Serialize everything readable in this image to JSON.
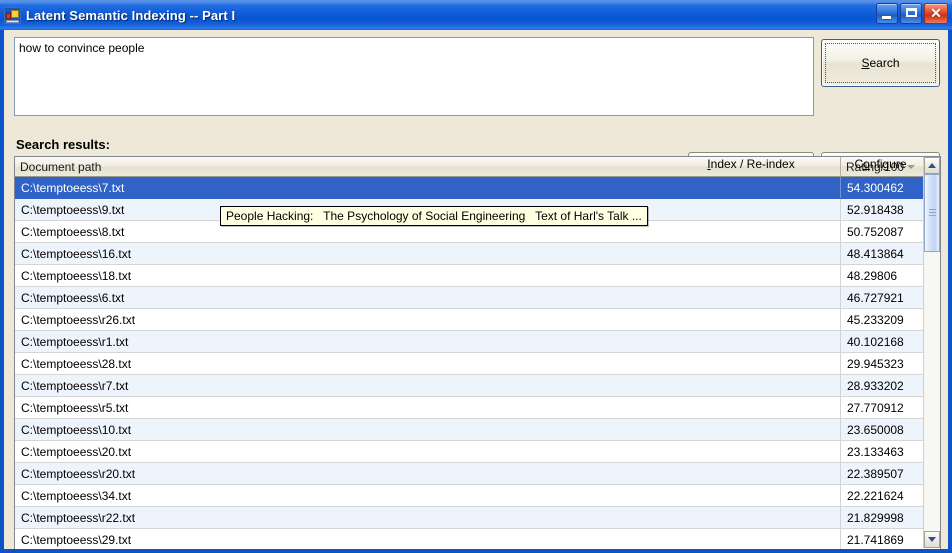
{
  "window": {
    "title": "Latent Semantic Indexing -- Part I",
    "icon": "app-icon",
    "minimize_label": "_",
    "maximize_label": "",
    "close_label": "✕",
    "titlebar_color": "#1C66DC",
    "client_background": "#EDE8D8"
  },
  "query": {
    "value": "how to convince people",
    "placeholder": ""
  },
  "buttons": {
    "search": {
      "prefix": "",
      "accel": "S",
      "suffix": "earch",
      "full": "Search"
    },
    "index": {
      "prefix": "",
      "accel": "I",
      "suffix": "ndex / Re-index",
      "full": "Index / Re-index"
    },
    "configure": {
      "prefix": "C",
      "accel": "o",
      "suffix": "nfigure",
      "full": "Configure"
    }
  },
  "results": {
    "label": "Search results:",
    "columns": [
      "Document path",
      "Rating/100"
    ],
    "selected_index": 0,
    "tooltip": "People Hacking:   The Psychology of Social Engineering   Text of Harl's Talk ...",
    "rows": [
      {
        "path": "C:\\temptoeess\\7.txt",
        "rating": "54.300462"
      },
      {
        "path": "C:\\temptoeess\\9.txt",
        "rating": "52.918438"
      },
      {
        "path": "C:\\temptoeess\\8.txt",
        "rating": "50.752087"
      },
      {
        "path": "C:\\temptoeess\\16.txt",
        "rating": "48.413864"
      },
      {
        "path": "C:\\temptoeess\\18.txt",
        "rating": "48.29806"
      },
      {
        "path": "C:\\temptoeess\\6.txt",
        "rating": "46.727921"
      },
      {
        "path": "C:\\temptoeess\\r26.txt",
        "rating": "45.233209"
      },
      {
        "path": "C:\\temptoeess\\r1.txt",
        "rating": "40.102168"
      },
      {
        "path": "C:\\temptoeess\\28.txt",
        "rating": "29.945323"
      },
      {
        "path": "C:\\temptoeess\\r7.txt",
        "rating": "28.933202"
      },
      {
        "path": "C:\\temptoeess\\r5.txt",
        "rating": "27.770912"
      },
      {
        "path": "C:\\temptoeess\\10.txt",
        "rating": "23.650008"
      },
      {
        "path": "C:\\temptoeess\\20.txt",
        "rating": "23.133463"
      },
      {
        "path": "C:\\temptoeess\\r20.txt",
        "rating": "22.389507"
      },
      {
        "path": "C:\\temptoeess\\34.txt",
        "rating": "22.221624"
      },
      {
        "path": "C:\\temptoeess\\r22.txt",
        "rating": "21.829998"
      },
      {
        "path": "C:\\temptoeess\\29.txt",
        "rating": "21.741869"
      }
    ]
  },
  "scrollbar": {
    "up_arrow": "▲",
    "down_arrow": "▼"
  }
}
